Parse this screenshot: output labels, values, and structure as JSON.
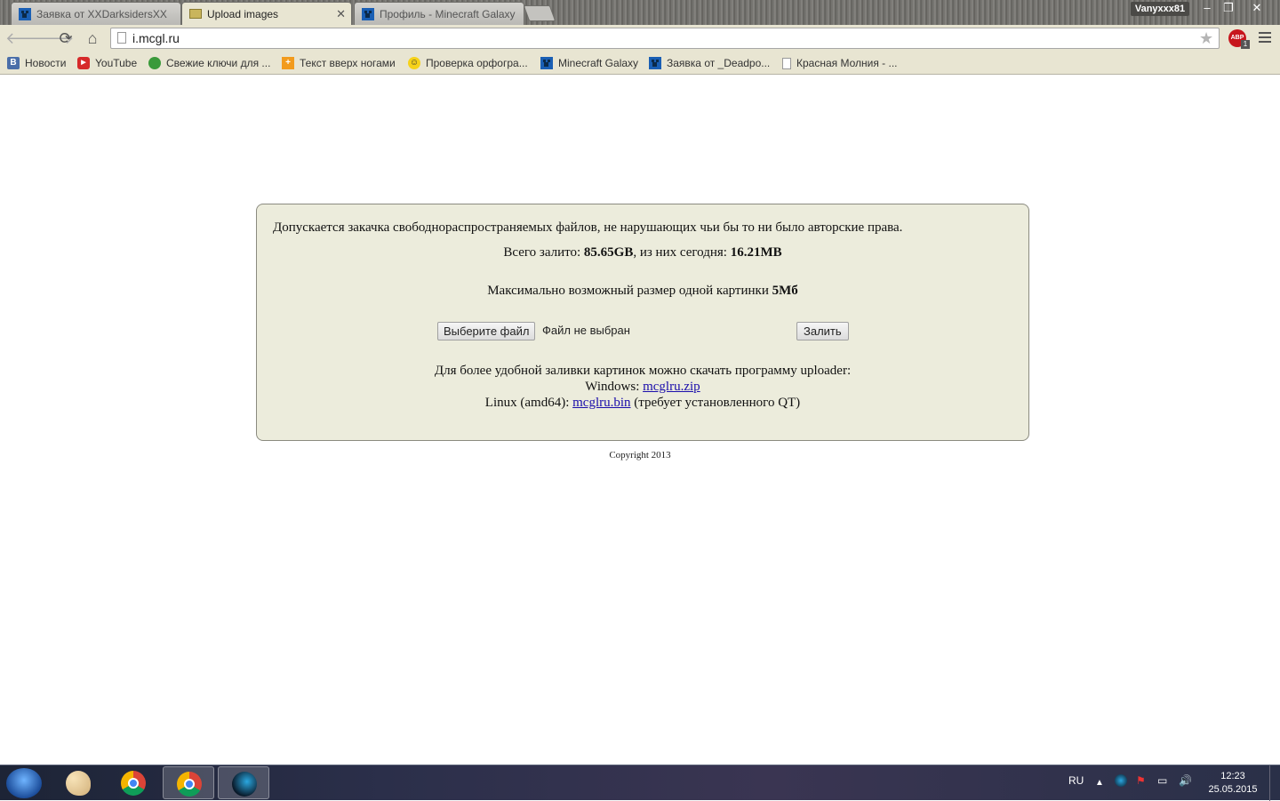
{
  "browser": {
    "tabs": [
      {
        "title": "Заявка от XXDarksidersXX",
        "active": false
      },
      {
        "title": "Upload images",
        "active": true
      },
      {
        "title": "Профиль - Minecraft Galaxy",
        "active": false
      }
    ],
    "user": "Vanyxxx81",
    "address": "i.mcgl.ru",
    "abp_label": "ABP",
    "abp_count": "1",
    "bookmarks": [
      {
        "label": "Новости",
        "icon": "vk-icon"
      },
      {
        "label": "YouTube",
        "icon": "youtube-icon"
      },
      {
        "label": "Свежие ключи для ...",
        "icon": "key-site-icon"
      },
      {
        "label": "Текст вверх ногами",
        "icon": "text-flip-icon"
      },
      {
        "label": "Проверка орфогра...",
        "icon": "smiley-icon"
      },
      {
        "label": "Minecraft Galaxy",
        "icon": "creeper-icon"
      },
      {
        "label": "Заявка от _Deadpo...",
        "icon": "creeper-icon"
      },
      {
        "label": "Красная Молния - ...",
        "icon": "page-icon"
      }
    ]
  },
  "page": {
    "notice": "Допускается закачка свободнораспространяемых файлов, не нарушающих чьи бы то ни было авторские права.",
    "stats": {
      "prefix": "Всего залито: ",
      "total": "85.65GB",
      "middle": ", из них сегодня: ",
      "today": "16.21MB"
    },
    "max_size": {
      "text": "Максимально возможный размер одной картинки ",
      "value": "5Мб"
    },
    "file_button": "Выберите файл",
    "file_status": "Файл не выбран",
    "submit_button": "Залить",
    "uploader": {
      "intro": "Для более удобной заливки картинок можно скачать программу uploader:",
      "windows_label": "Windows: ",
      "windows_link": "mcglru.zip",
      "linux_label": "Linux (amd64): ",
      "linux_link": "mcglru.bin",
      "linux_note": " (требует установленного QT)"
    },
    "copyright": "Copyright 2013"
  },
  "taskbar": {
    "language": "RU",
    "time": "12:23",
    "date": "25.05.2015"
  },
  "colors": {
    "panel_bg": "#ececdc",
    "chrome_bg": "#e8e5d2",
    "link": "#1a0dab"
  }
}
